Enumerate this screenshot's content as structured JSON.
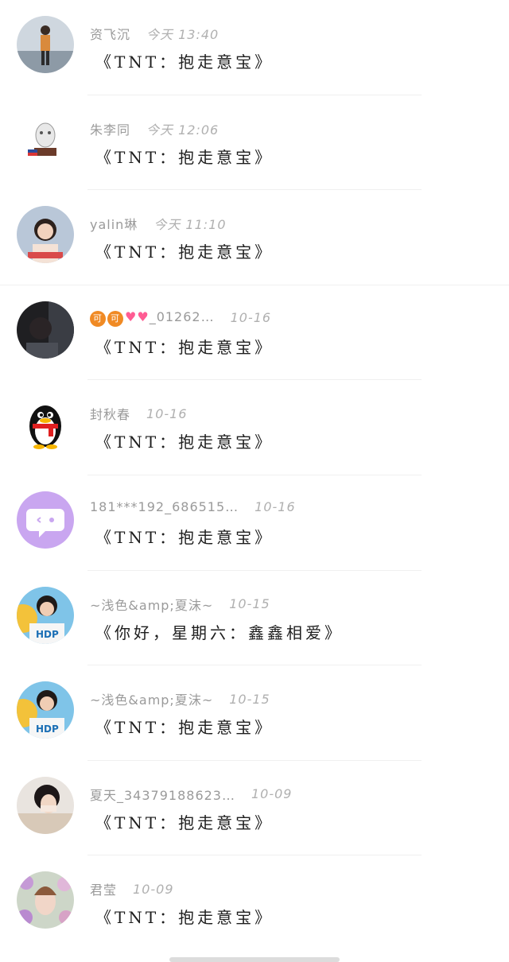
{
  "comments": [
    {
      "name": "资飞沉",
      "time": "今天 13:40",
      "message": "《TNT：抱走意宝》",
      "avatar": "girl-standing-photo"
    },
    {
      "name": "朱李同",
      "time": "今天 12:06",
      "message": "《TNT：抱走意宝》",
      "avatar": "mask-figure-photo"
    },
    {
      "name": "yalin琳",
      "time": "今天 11:10",
      "message": "《TNT：抱走意宝》",
      "avatar": "girl-portrait-photo"
    },
    {
      "name": "_01262…",
      "time": "10-16",
      "message": "《TNT：抱走意宝》",
      "avatar": "dark-portrait-photo",
      "name_prefix_badges": [
        "可",
        "可"
      ]
    },
    {
      "name": "封秋春",
      "time": "10-16",
      "message": "《TNT：抱走意宝》",
      "avatar": "penguin-icon"
    },
    {
      "name": "181***192_686515…",
      "time": "10-16",
      "message": "《TNT：抱走意宝》",
      "avatar": "chat-bubble-icon"
    },
    {
      "name": "~浅色&amp;夏沫~",
      "time": "10-15",
      "message": "《你好，星期六：鑫鑫相爱》",
      "avatar": "boy-portrait-photo"
    },
    {
      "name": "~浅色&amp;夏沫~",
      "time": "10-15",
      "message": "《TNT：抱走意宝》",
      "avatar": "boy-portrait-photo"
    },
    {
      "name": "夏天_34379188623…",
      "time": "10-09",
      "message": "《TNT：抱走意宝》",
      "avatar": "girl-cover-face-photo"
    },
    {
      "name": "君莹",
      "time": "10-09",
      "message": "《TNT：抱走意宝》",
      "avatar": "woman-flowers-photo"
    }
  ],
  "colors": {
    "name": "#9a9a9a",
    "message": "#1e1e1e",
    "divider": "#f0f0f0",
    "chat_icon_bg": "#c9a6f0"
  }
}
